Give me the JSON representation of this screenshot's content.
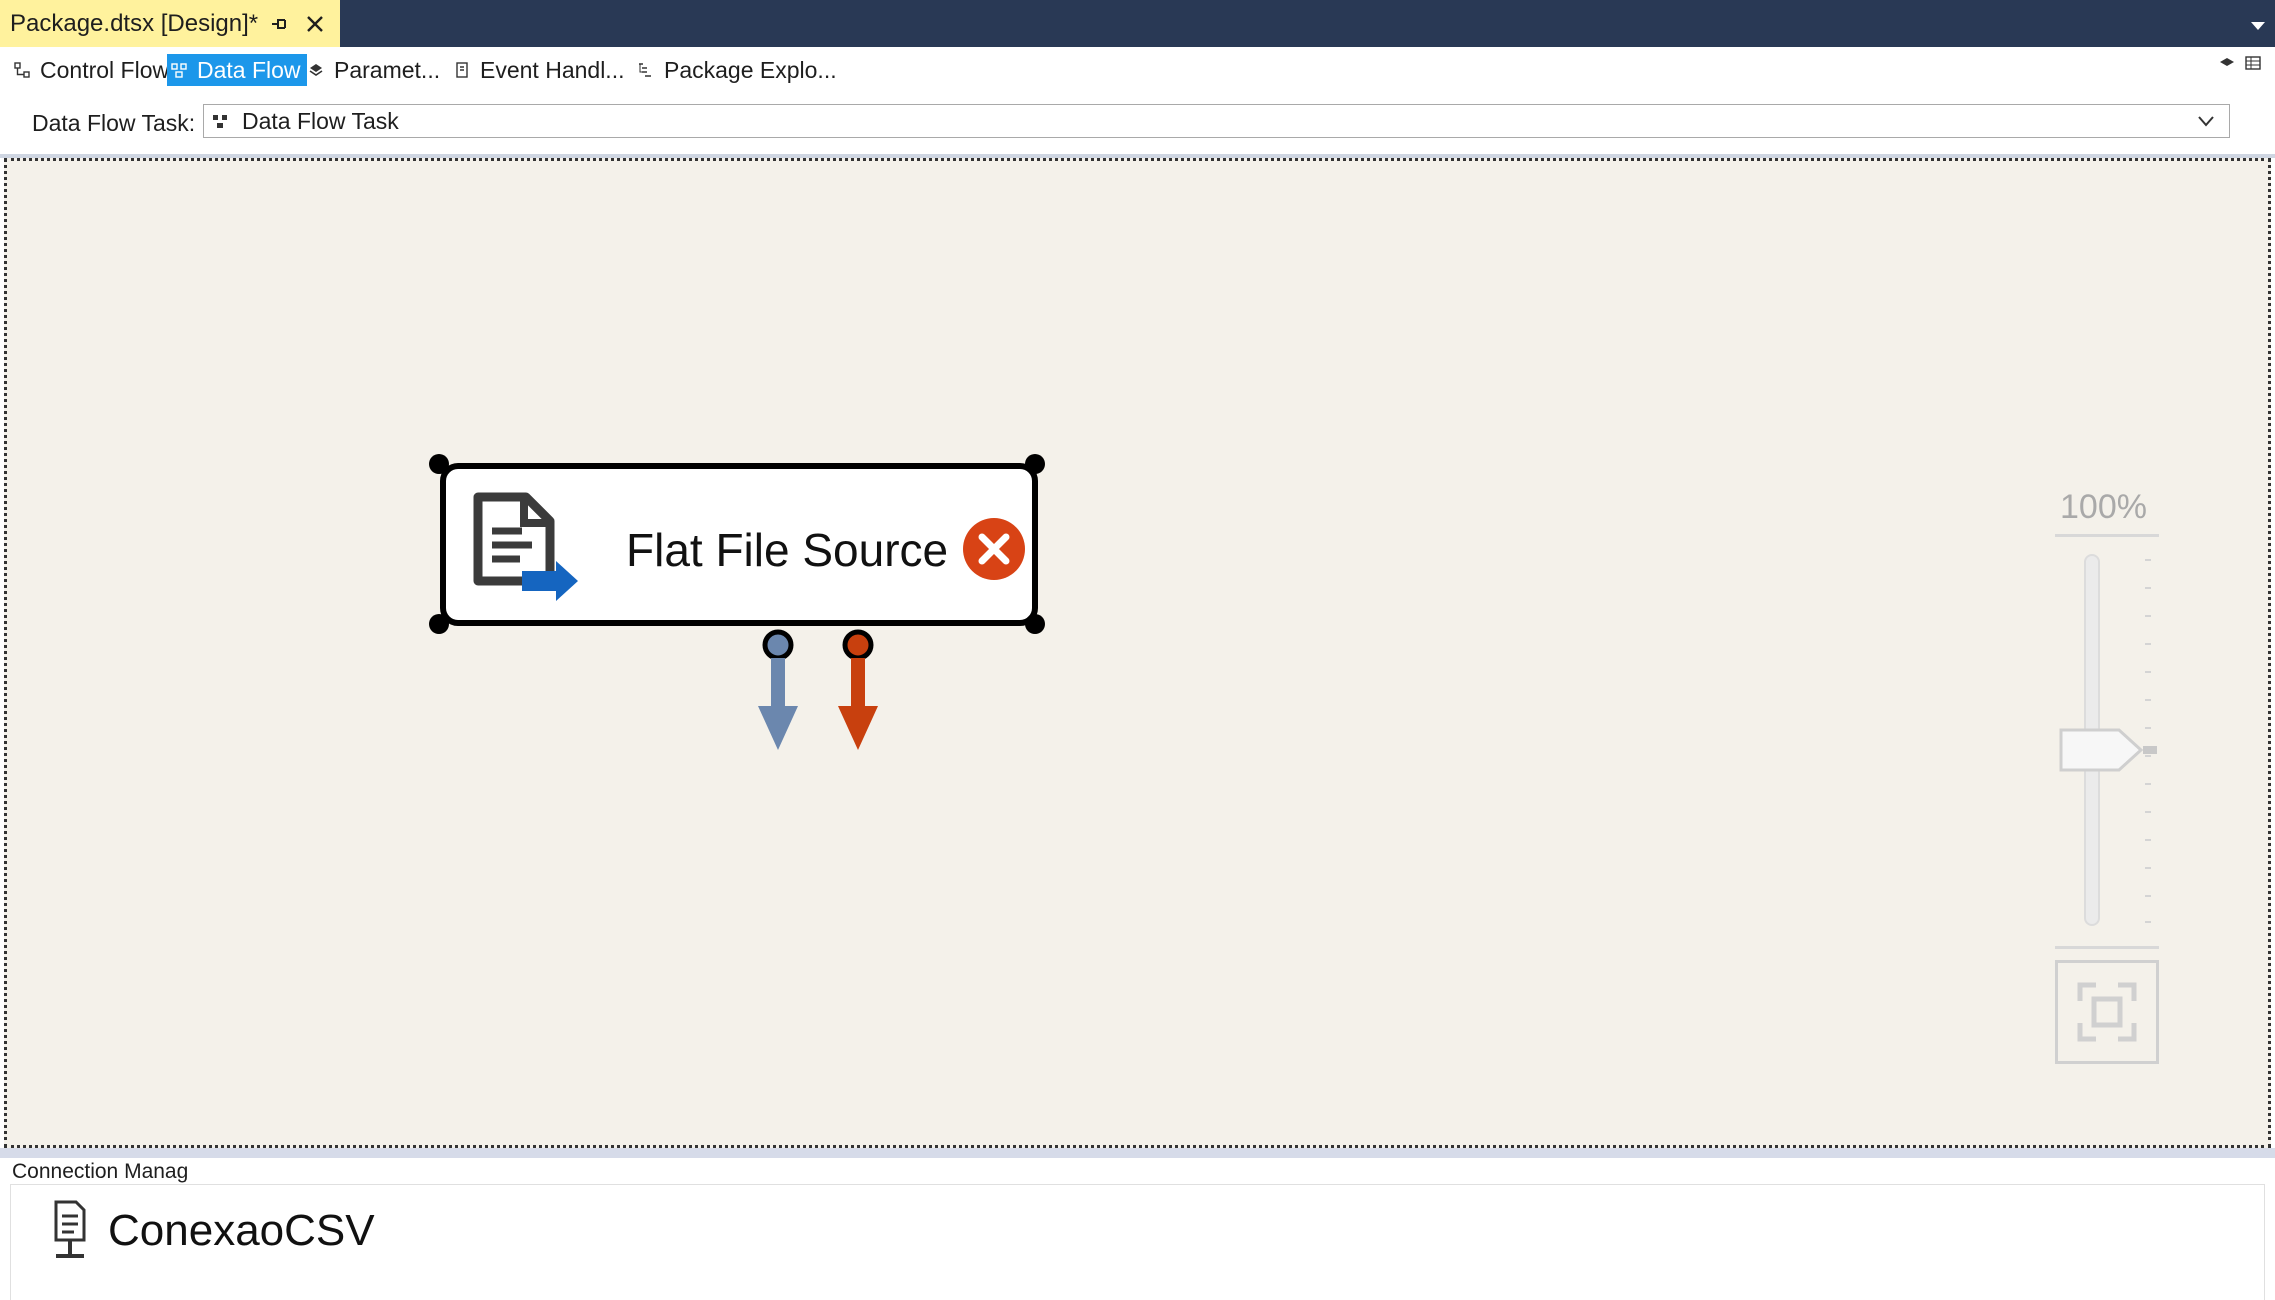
{
  "document_tab": {
    "title": "Package.dtsx [Design]*"
  },
  "designer_tabs": [
    {
      "label": "Control Flow",
      "icon": "control-flow-icon",
      "active": false
    },
    {
      "label": "Data Flow",
      "icon": "data-flow-icon",
      "active": true
    },
    {
      "label": "Paramet...",
      "icon": "parameters-icon",
      "active": false
    },
    {
      "label": "Event Handl...",
      "icon": "event-handlers-icon",
      "active": false
    },
    {
      "label": "Package Explo...",
      "icon": "package-explorer-icon",
      "active": false
    }
  ],
  "task_selector": {
    "label": "Data Flow Task:",
    "value": "Data Flow Task"
  },
  "canvas": {
    "component": {
      "label": "Flat File Source",
      "icon": "flat-file-source-icon",
      "status_icon": "error-icon"
    },
    "outputs": [
      {
        "name": "output-arrow",
        "color": "#6b87ae"
      },
      {
        "name": "error-output-arrow",
        "color": "#c8400e"
      }
    ],
    "zoom": {
      "label": "100%"
    }
  },
  "connection_managers": {
    "title": "Connection Manag",
    "items": [
      {
        "name": "ConexaoCSV",
        "icon": "flat-file-connection-icon"
      }
    ]
  },
  "colors": {
    "title_bar": "#293955",
    "doc_tab": "#fff29d",
    "active_tab": "#1c97ea",
    "canvas": "#f4f1ea",
    "error": "#d84315"
  }
}
